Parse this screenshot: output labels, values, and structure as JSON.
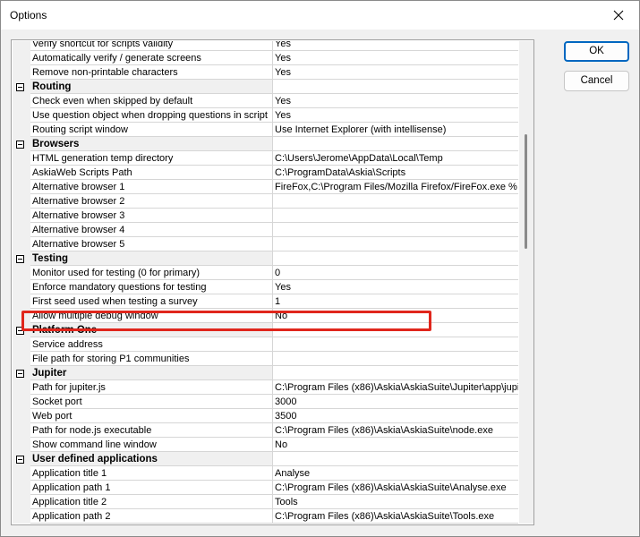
{
  "window": {
    "title": "Options"
  },
  "buttons": {
    "ok_label": "OK",
    "cancel_label": "Cancel"
  },
  "rows": [
    {
      "type": "item",
      "name": "Verify shortcut for scripts validity",
      "value": "Yes"
    },
    {
      "type": "item",
      "name": "Automatically verify / generate screens",
      "value": "Yes"
    },
    {
      "type": "item",
      "name": "Remove non-printable characters",
      "value": "Yes"
    },
    {
      "type": "category",
      "name": "Routing",
      "value": ""
    },
    {
      "type": "item",
      "name": "Check even when skipped by default",
      "value": "Yes"
    },
    {
      "type": "item",
      "name": "Use question object when dropping questions in script",
      "value": "Yes"
    },
    {
      "type": "item",
      "name": "Routing script window",
      "value": "Use Internet Explorer (with intellisense)"
    },
    {
      "type": "category",
      "name": "Browsers",
      "value": ""
    },
    {
      "type": "item",
      "name": "HTML generation temp directory",
      "value": "C:\\Users\\Jerome\\AppData\\Local\\Temp"
    },
    {
      "type": "item",
      "name": "AskiaWeb Scripts Path",
      "value": "C:\\ProgramData\\Askia\\Scripts"
    },
    {
      "type": "item",
      "name": "Alternative browser 1",
      "value": "FireFox,C:\\Program Files/Mozilla Firefox/FireFox.exe %"
    },
    {
      "type": "item",
      "name": "Alternative browser 2",
      "value": ""
    },
    {
      "type": "item",
      "name": "Alternative browser 3",
      "value": ""
    },
    {
      "type": "item",
      "name": "Alternative browser 4",
      "value": ""
    },
    {
      "type": "item",
      "name": "Alternative browser 5",
      "value": ""
    },
    {
      "type": "category",
      "name": "Testing",
      "value": ""
    },
    {
      "type": "item",
      "name": "Monitor used for testing (0 for primary)",
      "value": "0"
    },
    {
      "type": "item",
      "name": "Enforce mandatory questions for testing",
      "value": "Yes"
    },
    {
      "type": "item",
      "name": "First seed used when testing a survey",
      "value": "1"
    },
    {
      "type": "item",
      "name": "Allow multiple debug window",
      "value": "No"
    },
    {
      "type": "category",
      "name": "Platform One",
      "value": ""
    },
    {
      "type": "item",
      "name": "Service address",
      "value": ""
    },
    {
      "type": "item",
      "name": "File path for storing P1 communities",
      "value": ""
    },
    {
      "type": "category",
      "name": "Jupiter",
      "value": ""
    },
    {
      "type": "item",
      "name": "Path for jupiter.js",
      "value": "C:\\Program Files (x86)\\Askia\\AskiaSuite\\Jupiter\\app\\jupi"
    },
    {
      "type": "item",
      "name": "Socket port",
      "value": "3000"
    },
    {
      "type": "item",
      "name": "Web port",
      "value": "3500"
    },
    {
      "type": "item",
      "name": "Path for node.js executable",
      "value": "C:\\Program Files (x86)\\Askia\\AskiaSuite\\node.exe"
    },
    {
      "type": "item",
      "name": "Show command line window",
      "value": "No"
    },
    {
      "type": "category",
      "name": "User defined applications",
      "value": ""
    },
    {
      "type": "item",
      "name": "Application title 1",
      "value": "Analyse"
    },
    {
      "type": "item",
      "name": "Application path 1",
      "value": "C:\\Program Files (x86)\\Askia\\AskiaSuite\\Analyse.exe"
    },
    {
      "type": "item",
      "name": "Application title 2",
      "value": "Tools"
    },
    {
      "type": "item",
      "name": "Application path 2",
      "value": "C:\\Program Files (x86)\\Askia\\AskiaSuite\\Tools.exe"
    }
  ],
  "colors": {
    "highlight": "#e0261c",
    "accent": "#0067c0"
  },
  "icons": {
    "close": "close-icon",
    "collapse": "collapse-icon"
  }
}
